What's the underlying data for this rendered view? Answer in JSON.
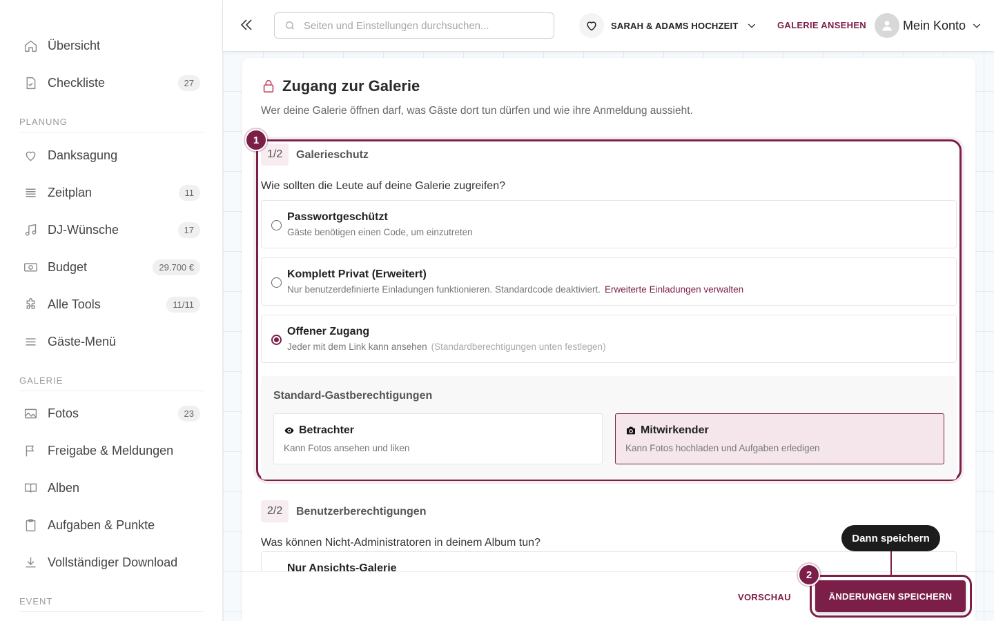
{
  "sidebar": {
    "items_top": [
      {
        "label": "Übersicht",
        "icon": "home-icon",
        "badge": ""
      },
      {
        "label": "Checkliste",
        "icon": "checklist-icon",
        "badge": "27"
      }
    ],
    "sections": [
      {
        "title": "PLANUNG",
        "items": [
          {
            "label": "Danksagung",
            "icon": "heart-icon",
            "badge": ""
          },
          {
            "label": "Zeitplan",
            "icon": "timeline-icon",
            "badge": "11"
          },
          {
            "label": "DJ-Wünsche",
            "icon": "music-icon",
            "badge": "17"
          },
          {
            "label": "Budget",
            "icon": "money-icon",
            "badge": "29.700 €"
          },
          {
            "label": "Alle Tools",
            "icon": "puzzle-icon",
            "badge": "11/11"
          },
          {
            "label": "Gäste-Menü",
            "icon": "menu-icon",
            "badge": ""
          }
        ]
      },
      {
        "title": "GALERIE",
        "items": [
          {
            "label": "Fotos",
            "icon": "image-icon",
            "badge": "23"
          },
          {
            "label": "Freigabe & Meldungen",
            "icon": "flag-icon",
            "badge": ""
          },
          {
            "label": "Alben",
            "icon": "book-icon",
            "badge": ""
          },
          {
            "label": "Aufgaben & Punkte",
            "icon": "clipboard-icon",
            "badge": ""
          },
          {
            "label": "Vollständiger Download",
            "icon": "download-icon",
            "badge": ""
          }
        ]
      },
      {
        "title": "EVENT",
        "items": []
      }
    ]
  },
  "topbar": {
    "search_placeholder": "Seiten und Einstellungen durchsuchen...",
    "event_name": "SARAH & ADAMS HOCHZEIT",
    "view_gallery": "GALERIE ANSEHEN",
    "account": "Mein Konto"
  },
  "card": {
    "title": "Zugang zur Galerie",
    "subtitle": "Wer deine Galerie öffnen darf, was Gäste dort tun dürfen und wie ihre Anmeldung aussieht.",
    "step1": {
      "badge": "1",
      "pill": "1/2",
      "title": "Galerieschutz",
      "question": "Wie sollten die Leute auf deine Galerie zugreifen?",
      "options": [
        {
          "title": "Passwortgeschützt",
          "desc": "Gäste benötigen einen Code, um einzutreten",
          "link": "",
          "hint": "",
          "checked": false
        },
        {
          "title": "Komplett Privat (Erweitert)",
          "desc": "Nur benutzerdefinierte Einladungen funktionieren. Standardcode deaktiviert.",
          "link": "Erweiterte Einladungen verwalten",
          "hint": "",
          "checked": false
        },
        {
          "title": "Offener Zugang",
          "desc": "Jeder mit dem Link kann ansehen",
          "link": "",
          "hint": "(Standardberechtigungen unten festlegen)",
          "checked": true
        }
      ],
      "permissions": {
        "title": "Standard-Gastberechtigungen",
        "viewer": {
          "title": "Betrachter",
          "desc": "Kann Fotos ansehen und liken"
        },
        "contributor": {
          "title": "Mitwirkender",
          "desc": "Kann Fotos hochladen und Aufgaben erledigen"
        }
      }
    },
    "step2": {
      "pill": "2/2",
      "title": "Benutzerberechtigungen",
      "question": "Was können Nicht-Administratoren in deinem Album tun?",
      "first_option": "Nur Ansichts-Galerie"
    }
  },
  "footer": {
    "preview": "VORSCHAU",
    "save": "ÄNDERUNGEN SPEICHERN",
    "tooltip": "Dann speichern",
    "save_badge": "2"
  },
  "colors": {
    "accent": "#7c1f48",
    "lock": "#c24a62"
  }
}
